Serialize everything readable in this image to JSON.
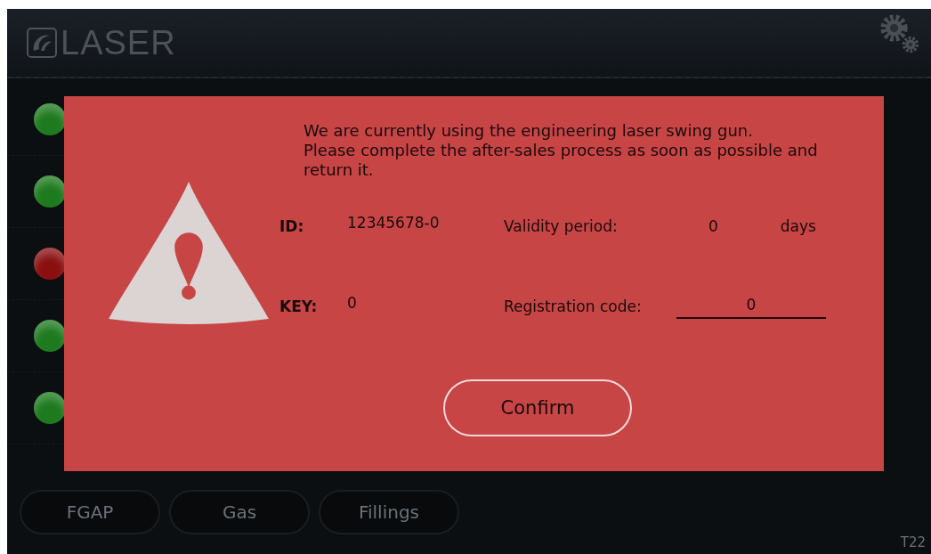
{
  "header": {
    "logo": "LASER"
  },
  "indicators": [
    {
      "color": "#1e7a1e"
    },
    {
      "color": "#1e7a1e"
    },
    {
      "color": "#8a1010"
    },
    {
      "color": "#1e7a1e"
    },
    {
      "color": "#1e7a1e"
    }
  ],
  "bottom_buttons": [
    "FGAP",
    "Gas",
    "Fillings"
  ],
  "version": "T22",
  "dialog": {
    "message": [
      "We are currently using the engineering laser swing gun.",
      "Please complete the after-sales process as soon as possible and return it."
    ],
    "rows": [
      [
        {
          "label": "ID:",
          "value": "12345678-0",
          "kind": "text"
        },
        {
          "label": "Validity period:",
          "value": "0",
          "unit": "days",
          "kind": "text"
        }
      ],
      [
        {
          "label": "KEY:",
          "value": "0",
          "kind": "text"
        },
        {
          "label": "Registration code:",
          "value": "0",
          "kind": "input"
        }
      ]
    ],
    "button": "Confirm"
  }
}
